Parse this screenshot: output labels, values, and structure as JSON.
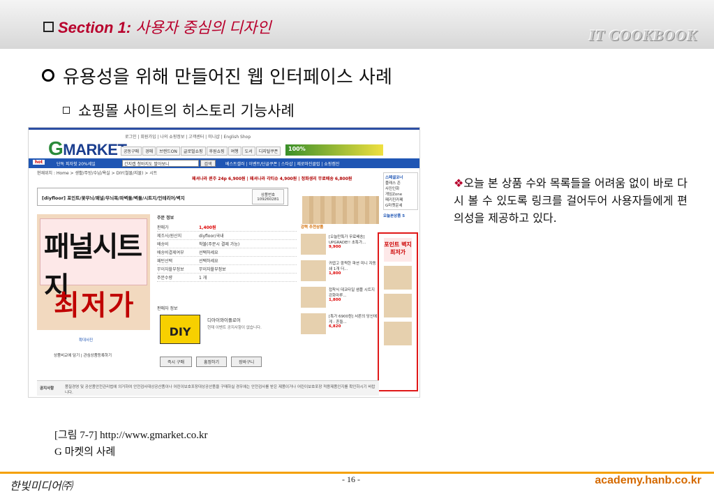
{
  "header": {
    "section_label": "Section 1:",
    "section_title": "사용자 중심의 디자인",
    "brand": "IT COOKBOOK"
  },
  "heading1": "유용성을 위해 만들어진 웹 인터페이스 사례",
  "heading2": "쇼핑몰 사이트의 히스토리 기능사례",
  "screenshot": {
    "logo_g": "G",
    "logo_rest": "MARKET",
    "top_links": "로그인 | 회원가입 | 나의 쇼핑정보 | 고객센터 | 미니샵 | English Shop",
    "nav": [
      "공동구매",
      "경매",
      "브랜드ON",
      "글로벌쇼핑",
      "후원쇼핑",
      "여행",
      "도서",
      "디지털쿠폰"
    ],
    "banner": "100%",
    "hot": "hot",
    "blue_text": "단독 피자헛 20%세일",
    "search_value": "간지캡 청바지도 팔아보니",
    "search_button": "검색",
    "blue_links": "베스트셀러 | 이벤트/단골쿠폰 | 스타샵 | 제로마진클럽 | 쇼핑캠진",
    "breadcrumb": "현재위치 : Home > 생활/주방/수납/욕실 > DIY(철물/지물) > 시트",
    "promo": "패셔나라 퀸주 24p 6,900원 | 패셔나라 각티슈 4,900원 | 정화생리 무료배송 6,800원",
    "product_title": "[diyfloor] 포인트/꽃무늬/패널/무늬목/파벽돌/벽돌/시트지/인테리어/벽지",
    "product_no_label": "상품번호",
    "product_no": "109260281",
    "image_text1": "패널시트지",
    "image_text2": "최저가",
    "info_head": "주문 정보",
    "info": [
      {
        "k": "판매가",
        "v": "1,400원"
      },
      {
        "k": "제조사/원산지",
        "v": "diyfloor/국내"
      },
      {
        "k": "배송비",
        "v": "착불(주문시 결제 가능)"
      },
      {
        "k": "배송비결제여부",
        "v": "선택하세요"
      },
      {
        "k": "패턴선택",
        "v": "선택하세요"
      },
      {
        "k": "무이자할부정보",
        "v": "무이자할부정보"
      },
      {
        "k": "주문수량",
        "v": "1 개"
      }
    ],
    "seller_head": "판매자 정보",
    "diy": "DIY",
    "seller_name": "디아이와이플로어",
    "seller_note": "현재 이벤트 공지사항이 없습니다.",
    "zoom": "확대사진",
    "left_buttons": "상품비교에 담기 | 관심상품등록하기",
    "buttons": [
      "즉시 구매",
      "흥정하기",
      "장바구니"
    ],
    "reco_head": "강력 추천상품",
    "recos": [
      {
        "text": "[오늘만특가 무료배송] UPGRADE!! 초특가...",
        "price": "9,900"
      },
      {
        "text": "귀엽고 깜찍한 파션 미니 자동쇄 1개 더...",
        "price": "1,800"
      },
      {
        "text": "접착식 데코타일 샘플 시트지 강화마루...",
        "price": "1,800"
      },
      {
        "text": "[특가 6900원] 서른의 당신에게 : 흔들...",
        "price": "6,820"
      }
    ],
    "side_head": "스페셜코너",
    "side_items": [
      "플래스 존",
      "사진인화",
      "게임Zone",
      "패키진카페",
      "G마켓운세"
    ],
    "today_head": "오늘본상품 5",
    "today_red": "포인트 벽지 최저가",
    "notice_label": "공지사항",
    "notice_text": "품질경영 및 공산품안전관리법에 의거하여 안전검사대상공산품이나 어린이보호포장대상공산품을 구매하실 경우에는 안전검사를 받은 제품이거나 어린이보호포장 적용제품인지를 확인하시기 바랍니다."
  },
  "description": {
    "marker": "❖",
    "text": "오늘 본 상품 수와 목록들을 어려움 없이 바로 다시 볼 수 있도록 링크를 걸어두어 사용자들에게 편의성을 제공하고 있다."
  },
  "caption": {
    "line1": "[그림 7-7] http://www.gmarket.co.kr",
    "line2": "G 마켓의 사례"
  },
  "footer": {
    "left": "한빛미디어㈜",
    "center": "- 16 -",
    "right": "academy.hanb.co.kr"
  }
}
